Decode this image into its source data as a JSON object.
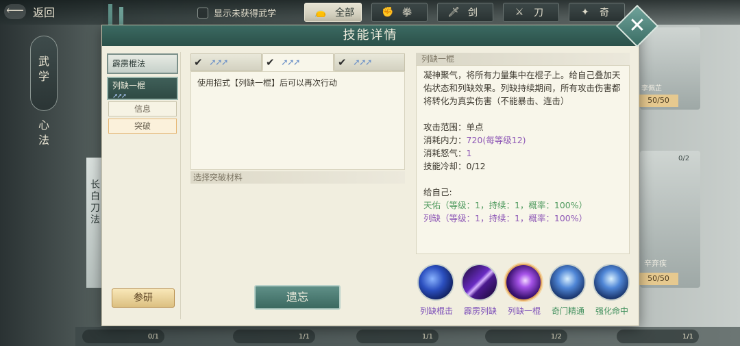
{
  "topbar": {
    "back_label": "返回",
    "show_unobtained": "显示未获得武学",
    "filters": [
      {
        "label": "全部",
        "icon": "bag-icon",
        "active": true
      },
      {
        "label": "拳",
        "icon": "fist-icon",
        "active": false
      },
      {
        "label": "剑",
        "icon": "sword-icon",
        "active": false
      },
      {
        "label": "刀",
        "icon": "blade-icon",
        "active": false
      },
      {
        "label": "奇",
        "icon": "shuriken-icon",
        "active": false
      }
    ]
  },
  "side_menu": {
    "items": [
      {
        "label": "武学",
        "active": true
      },
      {
        "label": "心法",
        "active": false
      }
    ]
  },
  "background": {
    "left_card_text": "长白刀法",
    "right_badge_1": "50/50",
    "right_badge_2": "50/50",
    "right_name": "辛弃疾",
    "right_count": "0/2",
    "right_top_text": "李佩芷",
    "bottom_counts": [
      "0/1",
      "1/1",
      "1/1",
      "1/2",
      "1/1"
    ]
  },
  "dialog": {
    "title": "技能详情",
    "skills": [
      {
        "name": "霹雳棍法",
        "selected": false
      },
      {
        "name": "列缺一棍",
        "selected": true
      }
    ],
    "mini_tabs": {
      "info": "信息",
      "breakthrough": "突破"
    },
    "research_label": "参研",
    "level_tabs": [
      {
        "checked": true,
        "active": false
      },
      {
        "checked": true,
        "active": true
      },
      {
        "checked": true,
        "active": false
      }
    ],
    "description": "使用招式【列缺一棍】后可以再次行动",
    "materials_header": "选择突破材料",
    "forget_label": "遗忘",
    "detail": {
      "header": "列缺一棍",
      "summary": "凝神聚气，将所有力量集中在棍子上。给自己叠加天佑状态和列缺效果。列缺持续期间，所有攻击伤害都将转化为真实伤害（不能暴击、连击）",
      "range_label": "攻击范围：",
      "range_value": "单点",
      "mp_label": "消耗内力：",
      "mp_value": "720(每等级12)",
      "rage_label": "消耗怒气：",
      "rage_value": "1",
      "cd_label": "技能冷却：",
      "cd_value": "0/12",
      "self_label": "给自己:",
      "effect_1": "天佑（等级：1，持续：1，概率：100%）",
      "effect_2": "列缺（等级：1，持续：1，概率：100%）"
    },
    "related_skills": [
      {
        "name": "列缺棍击",
        "color": "#7b4db8",
        "icon": "blue-orb-icon"
      },
      {
        "name": "霹雳列缺",
        "color": "#7b4db8",
        "icon": "purple-slash-icon"
      },
      {
        "name": "列缺一棍",
        "color": "#7b4db8",
        "icon": "purple-burst-icon",
        "selected": true
      },
      {
        "name": "奇门精通",
        "color": "#3f8f5c",
        "icon": "green-figure-icon"
      },
      {
        "name": "强化命中",
        "color": "#3f8f5c",
        "icon": "green-figure-icon"
      }
    ]
  }
}
